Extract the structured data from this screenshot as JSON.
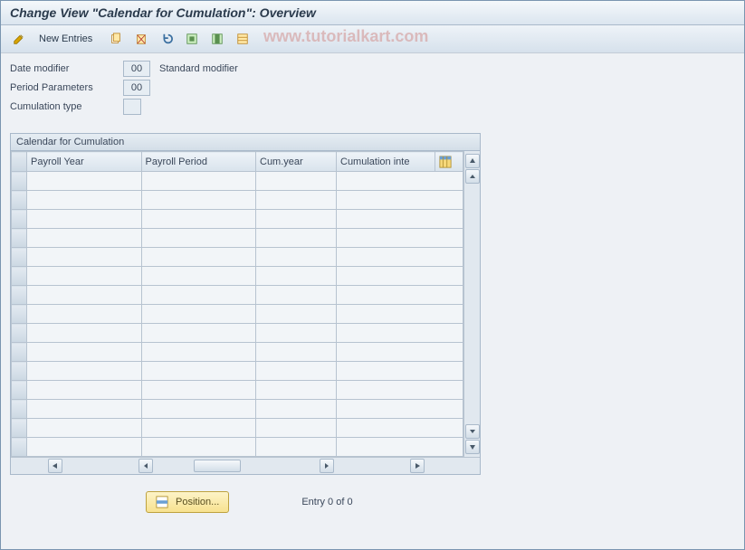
{
  "title": "Change View \"Calendar for Cumulation\": Overview",
  "toolbar": {
    "new_entries_label": "New Entries"
  },
  "watermark": "www.tutorialkart.com",
  "fields": {
    "date_modifier": {
      "label": "Date modifier",
      "value": "00",
      "desc": "Standard modifier"
    },
    "period_params": {
      "label": "Period Parameters",
      "value": "00"
    },
    "cumulation_type": {
      "label": "Cumulation type",
      "value": ""
    }
  },
  "group": {
    "title": "Calendar for Cumulation",
    "columns": [
      "Payroll Year",
      "Payroll Period",
      "Cum.year",
      "Cumulation inte"
    ],
    "rows": 15
  },
  "footer": {
    "position_label": "Position...",
    "entry_status": "Entry 0 of 0"
  }
}
